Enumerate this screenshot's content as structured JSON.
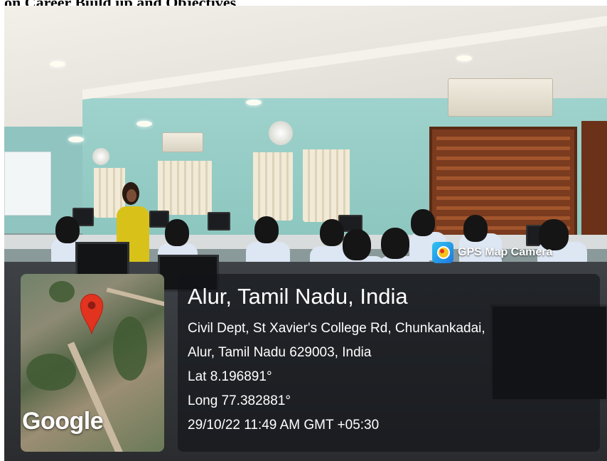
{
  "document": {
    "heading": "on Career Build up and Objectives"
  },
  "photo_overlay": {
    "badge": {
      "icon": "gps-map-camera-icon",
      "label": "GPS Map Camera"
    },
    "map": {
      "provider_label": "Google",
      "pin_icon": "location-pin-icon",
      "pin_color": "#e2331f"
    },
    "location": {
      "title": "Alur, Tamil Nadu, India",
      "address_line1": "Civil Dept, St Xavier's College Rd, Chunkankadai,",
      "address_line2": "Alur, Tamil Nadu 629003, India",
      "latitude": "Lat 8.196891°",
      "longitude": "Long 77.382881°",
      "timestamp": "29/10/22 11:49 AM GMT +05:30"
    },
    "panel_color": "#121418"
  }
}
